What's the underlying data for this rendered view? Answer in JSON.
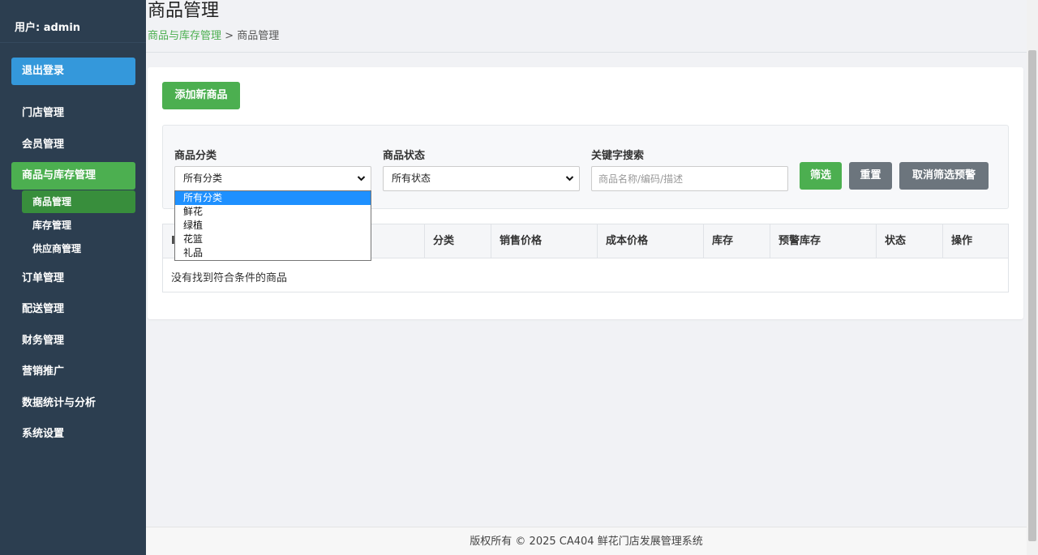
{
  "sidebar": {
    "user": "用户: admin",
    "logout": "退出登录",
    "items": [
      {
        "label": "门店管理"
      },
      {
        "label": "会员管理"
      },
      {
        "label": "商品与库存管理"
      },
      {
        "label": "订单管理"
      },
      {
        "label": "配送管理"
      },
      {
        "label": "财务管理"
      },
      {
        "label": "营销推广"
      },
      {
        "label": "数据统计与分析"
      },
      {
        "label": "系统设置"
      }
    ],
    "subitems": [
      {
        "label": "商品管理"
      },
      {
        "label": "库存管理"
      },
      {
        "label": "供应商管理"
      }
    ]
  },
  "header": {
    "title": "商品管理",
    "breadcrumb_link": "商品与库存管理",
    "breadcrumb_sep": ">",
    "breadcrumb_current": "商品管理"
  },
  "toolbar": {
    "add_label": "添加新商品"
  },
  "filters": {
    "category_label": "商品分类",
    "category_value": "所有分类",
    "status_label": "商品状态",
    "status_value": "所有状态",
    "keyword_label": "关键字搜索",
    "keyword_placeholder": "商品名称/编码/描述",
    "filter_btn": "筛选",
    "reset_btn": "重置",
    "cancel_alert_btn": "取消筛选预警",
    "category_options": [
      "所有分类",
      "鲜花",
      "绿植",
      "花篮",
      "礼品"
    ]
  },
  "table": {
    "columns": [
      "I",
      "分类",
      "销售价格",
      "成本价格",
      "库存",
      "预警库存",
      "状态",
      "操作"
    ],
    "empty_text": "没有找到符合条件的商品"
  },
  "footer": {
    "text": "版权所有 © 2025 CA404 鲜花门店发展管理系统"
  },
  "colors": {
    "sidebar_bg": "#2c3e50",
    "accent_green": "#4caf50",
    "logout_blue": "#3498db",
    "gray_button": "#6c757d",
    "dropdown_selected": "#1e90ff"
  }
}
